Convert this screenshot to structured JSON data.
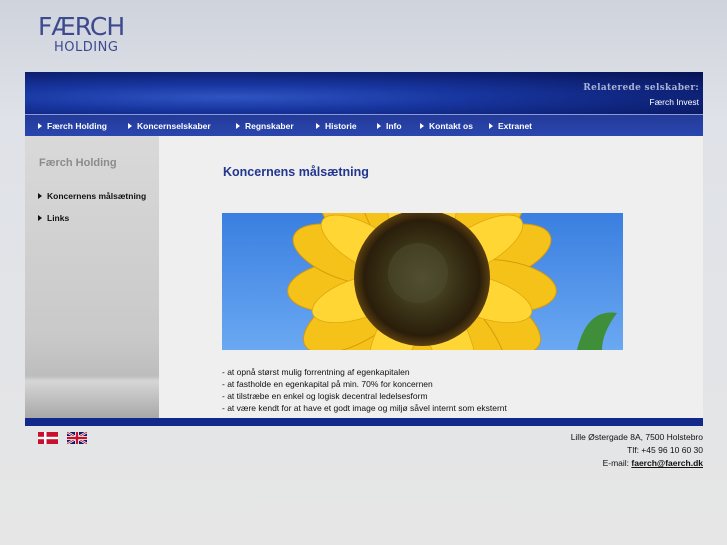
{
  "logo": {
    "line1": "FÆRCH",
    "line2": "HOLDING"
  },
  "banner": {
    "related_title": "Relaterede selskaber:",
    "related_company": "Færch Invest"
  },
  "nav": {
    "items": [
      {
        "label": "Færch Holding"
      },
      {
        "label": "Koncernselskaber"
      },
      {
        "label": "Regnskaber"
      },
      {
        "label": "Historie"
      },
      {
        "label": "Info"
      },
      {
        "label": "Kontakt os"
      },
      {
        "label": "Extranet"
      }
    ]
  },
  "sidebar": {
    "title": "Færch Holding",
    "links": [
      {
        "label": "Koncernens målsætning"
      },
      {
        "label": "Links"
      }
    ]
  },
  "content": {
    "heading": "Koncernens målsætning",
    "image_alt": "sunflower",
    "goals": [
      "- at opnå størst mulig forrentning af egenkapitalen",
      "- at fastholde en egenkapital på min. 70% for koncernen",
      "- at tilstræbe en enkel og logisk decentral ledelsesform",
      "- at være kendt for at have et godt image og miljø såvel internt som eksternt"
    ]
  },
  "footer": {
    "address": "Lille Østergade 8A, 7500 Holstebro",
    "phone": "Tlf: +45 96 10 60 30",
    "email_label": "E-mail:",
    "email": "faerch@faerch.dk",
    "languages": [
      {
        "name": "Danish",
        "icon": "danish-flag-icon"
      },
      {
        "name": "English",
        "icon": "uk-flag-icon"
      }
    ]
  },
  "colors": {
    "brand_blue": "#1a2f8c",
    "nav_blue": "#2a47b0",
    "heading_blue": "#23368f",
    "logo_blue": "#3d4a8f"
  }
}
